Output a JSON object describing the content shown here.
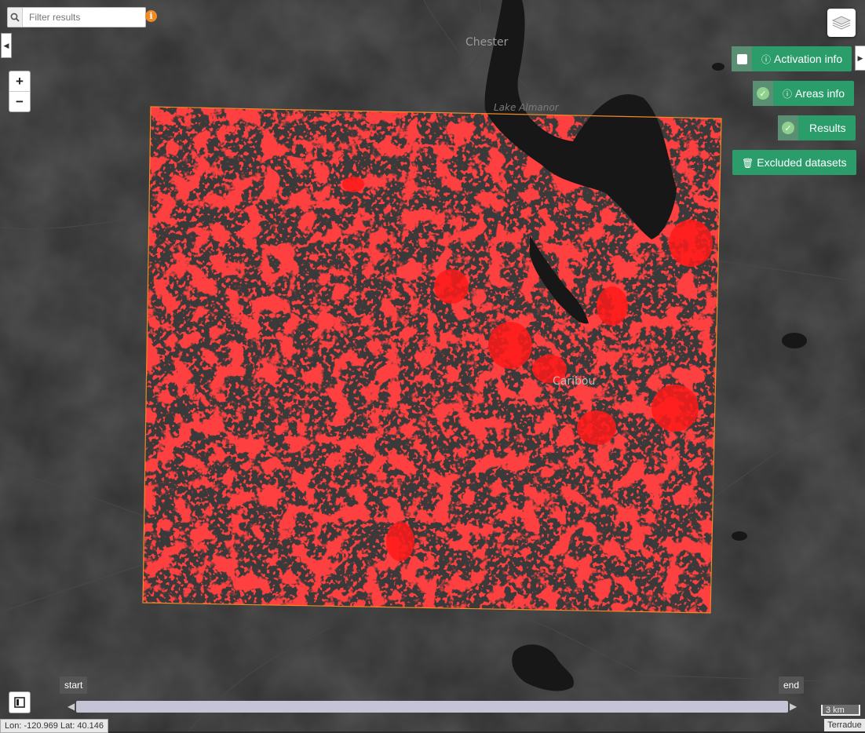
{
  "search": {
    "placeholder": "Filter results"
  },
  "info_badge": "i",
  "zoom": {
    "in_label": "+",
    "out_label": "−"
  },
  "panels": {
    "activation_info": {
      "label": "Activation info",
      "checked": false
    },
    "areas_info": {
      "label": "Areas info",
      "checked": true
    },
    "results": {
      "label": "Results",
      "checked": true
    },
    "excluded_datasets": {
      "label": "Excluded datasets"
    }
  },
  "map_labels": {
    "chester": "Chester",
    "lake_almanor": "Lake Almanor",
    "caribou": "Caribou"
  },
  "timeline": {
    "start_label": "start",
    "end_label": "end"
  },
  "coords_readout": "Lon: -120.969 Lat: 40.146",
  "scale_label": "3 km",
  "attribution": "Terradue",
  "colors": {
    "accent_green": "#2a9d6b",
    "result_red": "#ff1a1a",
    "aoi_outline": "#f08a24",
    "lake": "#161616"
  },
  "icons": {
    "search": "search-icon",
    "layers": "layers-icon",
    "info": "info-circle-icon",
    "trash": "trash-icon",
    "legend": "legend-icon"
  }
}
